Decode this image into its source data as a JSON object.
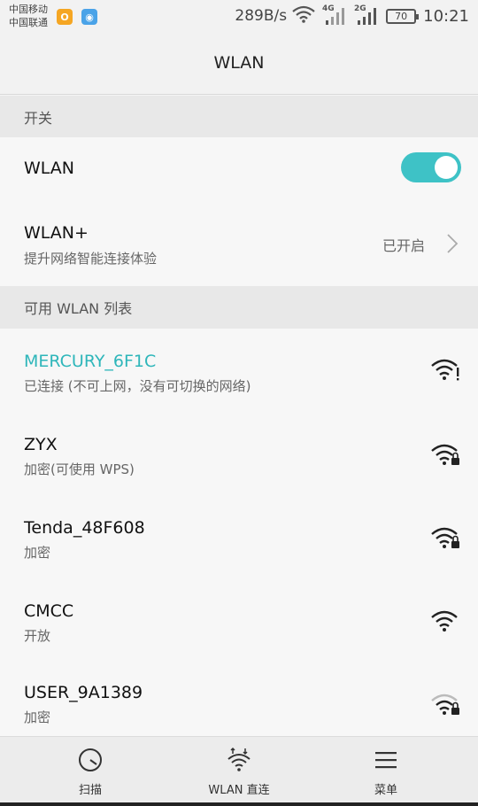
{
  "status_bar": {
    "carrier1": "中国移动",
    "carrier2": "中国联通",
    "app_icon_a": "O",
    "app_icon_b": "◉",
    "speed": "289B/s",
    "net1": "4G",
    "net2": "2G",
    "battery": "70",
    "time": "10:21"
  },
  "header": {
    "title": "WLAN"
  },
  "switch_section": {
    "header": "开关",
    "wlan_label": "WLAN",
    "wlan_enabled": true,
    "wlan_plus_label": "WLAN+",
    "wlan_plus_sub": "提升网络智能连接体验",
    "wlan_plus_status": "已开启"
  },
  "networks_section": {
    "header": "可用 WLAN 列表",
    "networks": [
      {
        "name": "MERCURY_6F1C",
        "status": "已连接 (不可上网，没有可切换的网络)",
        "connected": true,
        "secured": false,
        "icon": "wifi-warning-icon"
      },
      {
        "name": "ZYX",
        "status": "加密(可使用 WPS)",
        "connected": false,
        "secured": true,
        "icon": "wifi-lock-icon"
      },
      {
        "name": "Tenda_48F608",
        "status": "加密",
        "connected": false,
        "secured": true,
        "icon": "wifi-lock-icon"
      },
      {
        "name": "CMCC",
        "status": "开放",
        "connected": false,
        "secured": false,
        "icon": "wifi-icon"
      },
      {
        "name": "USER_9A1389",
        "status": "加密",
        "connected": false,
        "secured": true,
        "icon": "wifi-lock-weak-icon"
      }
    ]
  },
  "bottom_bar": {
    "scan": "扫描",
    "direct": "WLAN 直连",
    "menu": "菜单"
  },
  "colors": {
    "accent": "#3ec2c6",
    "connected_text": "#2eb6ba"
  }
}
